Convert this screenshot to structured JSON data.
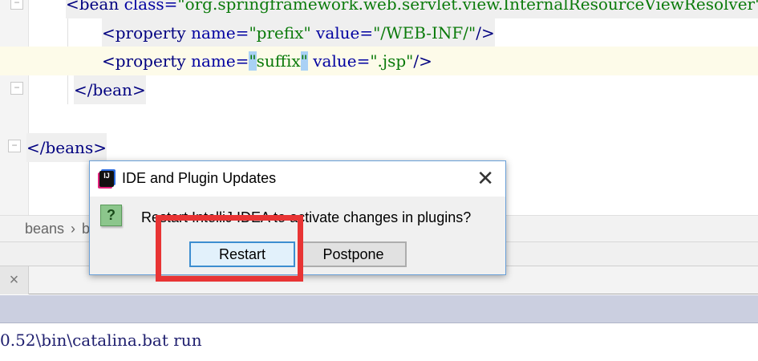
{
  "editor": {
    "lines": [
      {
        "open": "<bean ",
        "attr": "class=",
        "val": "\"org.springframework.web.servlet.view.InternalResourceViewResolver\""
      },
      {
        "open": "<property ",
        "a1": "name=",
        "v1": "\"prefix\"",
        "a2": " value=",
        "v2": "\"/WEB-INF/\"",
        "close": "/>"
      },
      {
        "open": "<property ",
        "a1": "name=",
        "q1": "\"",
        "v1": "suffix",
        "q2": "\"",
        "a2": " value=",
        "v2": "\".jsp\"",
        "close": "/>"
      },
      {
        "text": "</bean>"
      },
      {
        "text": "</beans>"
      }
    ]
  },
  "breadcrumb": {
    "items": [
      "beans",
      "bean"
    ],
    "separator": "›"
  },
  "tabs": {
    "close_label": "×"
  },
  "console": {
    "text": "0.52\\bin\\catalina.bat run"
  },
  "dialog": {
    "title": "IDE and Plugin Updates",
    "logo": "IJ",
    "close": "✕",
    "icon": "?",
    "message": "Restart IntelliJ IDEA to activate changes in plugins?",
    "buttons": {
      "restart": "Restart",
      "postpone": "Postpone"
    }
  },
  "colors": {
    "highlight_box": "#e83434",
    "accent": "#3d8ed0"
  }
}
